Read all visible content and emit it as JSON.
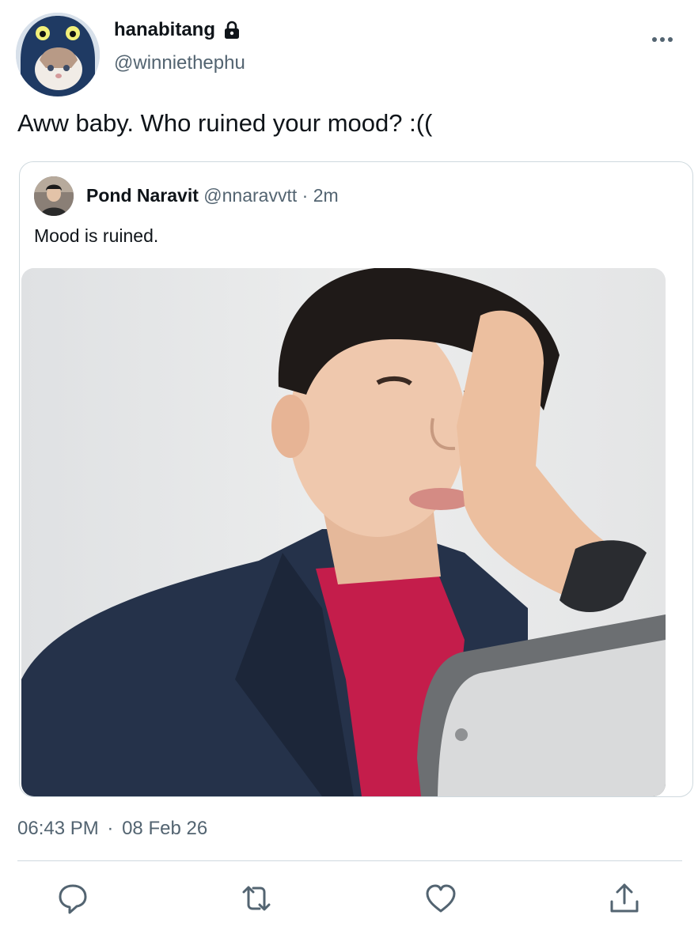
{
  "author": {
    "display_name": "hanabitang",
    "handle": "@winniethephu",
    "protected": true
  },
  "tweet": {
    "text": "Aww baby. Who ruined your mood? :(("
  },
  "quoted": {
    "display_name": "Pond Naravit",
    "handle": "@nnaravvtt",
    "separator": "·",
    "time": "2m",
    "text": "Mood is ruined."
  },
  "meta": {
    "time": "06:43 PM",
    "separator": "·",
    "date": "08 Feb 26"
  },
  "icons": {
    "more": "more-dots-icon",
    "reply": "reply-icon",
    "retweet": "retweet-icon",
    "like": "heart-icon",
    "share": "share-icon",
    "lock": "lock-icon"
  },
  "colors": {
    "text": "#0f1419",
    "secondary": "#536471",
    "border": "#cfd9de",
    "icon": "#536471"
  }
}
